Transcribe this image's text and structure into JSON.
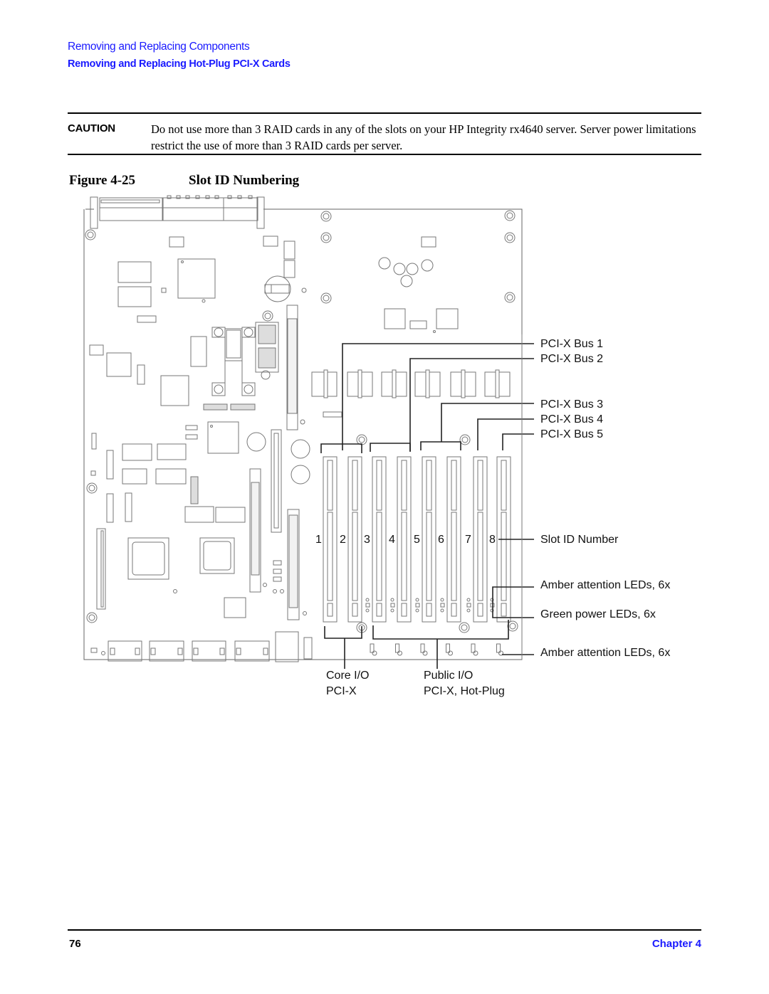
{
  "header": {
    "section": "Removing and Replacing Components",
    "subsection": "Removing and Replacing Hot-Plug PCI-X Cards"
  },
  "caution": {
    "label": "CAUTION",
    "text": "Do not use more than 3 RAID cards in any of the slots on your HP Integrity rx4640 server. Server power limitations restrict the use of more than 3 RAID cards per server."
  },
  "figure": {
    "number": "Figure 4-25",
    "title": "Slot ID Numbering",
    "bus_labels": [
      "PCI-X Bus 1",
      "PCI-X Bus 2",
      "PCI-X Bus 3",
      "PCI-X Bus 4",
      "PCI-X Bus 5"
    ],
    "slot_numbers": [
      "1",
      "2",
      "3",
      "4",
      "5",
      "6",
      "7",
      "8"
    ],
    "callouts": {
      "slot_id": "Slot ID Number",
      "amber_leds_1": "Amber attention LEDs, 6x",
      "green_leds": "Green power LEDs, 6x",
      "amber_leds_2": "Amber attention LEDs, 6x"
    },
    "groups": {
      "core_line1": "Core I/O",
      "core_line2": "PCI-X",
      "public_line1": "Public I/O",
      "public_line2": "PCI-X, Hot-Plug"
    }
  },
  "footer": {
    "page_number": "76",
    "chapter": "Chapter 4"
  }
}
